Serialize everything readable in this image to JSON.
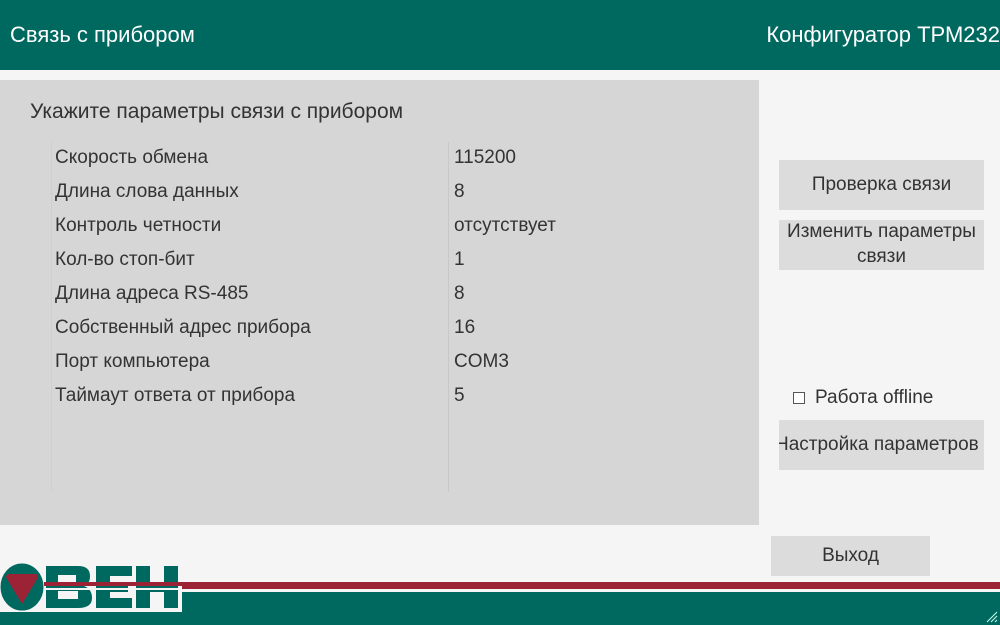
{
  "header": {
    "left_title": "Связь с прибором",
    "right_title": "Конфигуратор ТРМ232"
  },
  "panel": {
    "heading": "Укажите параметры связи с прибором",
    "params": [
      {
        "name": "Скорость обмена",
        "value": "115200"
      },
      {
        "name": "Длина слова данных",
        "value": "8"
      },
      {
        "name": "Контроль четности",
        "value": "отсутствует"
      },
      {
        "name": "Кол-во стоп-бит",
        "value": "1"
      },
      {
        "name": "Длина адреса RS-485",
        "value": "8"
      },
      {
        "name": "Собственный адрес прибора",
        "value": "16"
      },
      {
        "name": "Порт компьютера",
        "value": "COM3"
      },
      {
        "name": "Таймаут ответа от прибора",
        "value": "5"
      }
    ]
  },
  "actions": {
    "check_label": "Проверка связи",
    "change_label": "Изменить параметры связи",
    "offline_label": "Работа offline",
    "offline_checked": false,
    "settings_label": "Настройка параметров",
    "exit_label": "Выход"
  },
  "colors": {
    "brand_green": "#00695f",
    "brand_red": "#9b2335",
    "panel_bg": "#d6d6d6",
    "button_bg": "#dcdcdc"
  },
  "icons": {
    "logo": "oven-logo",
    "resize": "resize-grip-icon",
    "checkbox": "checkbox-unchecked"
  }
}
